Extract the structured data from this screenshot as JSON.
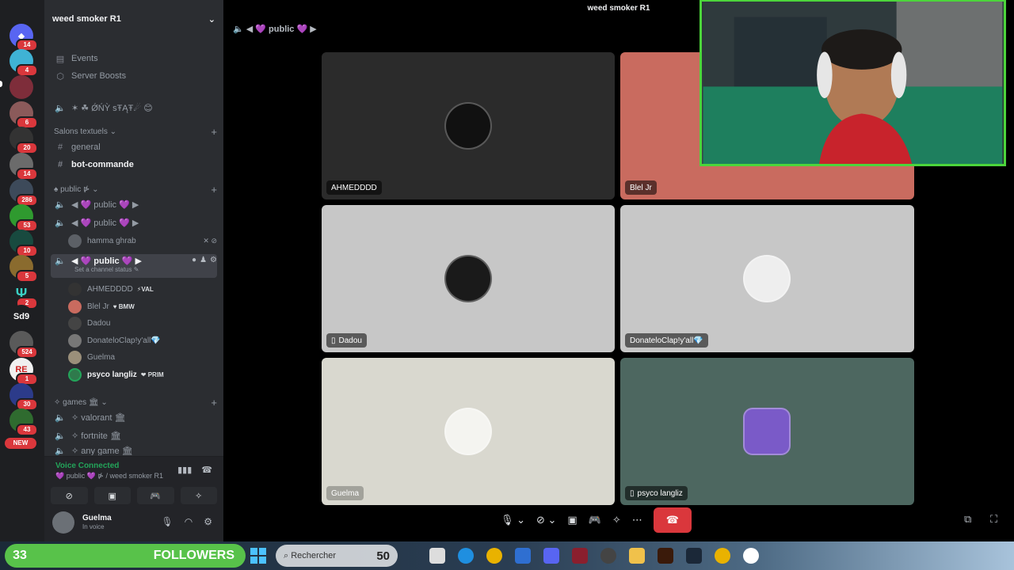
{
  "window": {
    "title": "weed smoker R1"
  },
  "server_rail": {
    "badges": [
      "14",
      "4",
      "",
      "6",
      "20",
      "14",
      "286",
      "53",
      "10",
      "5",
      "2",
      "",
      "524",
      "1",
      "30",
      "43"
    ],
    "text_server": "Sd9",
    "new_label": "NEW"
  },
  "sidebar": {
    "server_name": "weed smoker R1",
    "events": "Events",
    "boosts": "Server Boosts",
    "onlystat": "✶ ☘ ǾŃỲ sŦĄŦ☄ 😊",
    "cat_text": "Salons textuels",
    "general": "general",
    "bot_commande": "bot-commande",
    "cat_public": "♠ public ⋫",
    "voice1": "◀ 💜 public 💜 ▶",
    "voice2": "◀ 💜 public 💜 ▶",
    "voice2_member": "hamma ghrab",
    "voice_active": "◀ 💜 public 💜 ▶",
    "set_status": "Set a channel status ✎",
    "members": [
      {
        "name": "AHMEDDDD",
        "tag": "⚡VAL"
      },
      {
        "name": "Blel Jr",
        "tag": "♥ BMW"
      },
      {
        "name": "Dadou",
        "tag": ""
      },
      {
        "name": "DonateloClap!y'all💎",
        "tag": ""
      },
      {
        "name": "Guelma",
        "tag": ""
      },
      {
        "name": "psyco langliz",
        "tag": "❤ PRIM"
      }
    ],
    "cat_games": "✧ games 🏛",
    "valorant": "✧ valorant 🏛",
    "fortnite": "✧ fortnite 🏛",
    "anygame": "✧ any game 🏛"
  },
  "voice_panel": {
    "status": "Voice Connected",
    "location": "💜 public 💜 ⋫ / weed smoker R1"
  },
  "user": {
    "name": "Guelma",
    "status": "In voice"
  },
  "main": {
    "channel_title": "◀ 💜 public 💜 ▶",
    "tiles": [
      {
        "name": "AHMEDDDD",
        "mobile": false,
        "color": "#2b2b2b"
      },
      {
        "name": "Blel Jr",
        "mobile": false,
        "color": "#c96b5f"
      },
      {
        "name": "Dadou",
        "mobile": true,
        "color": "#c7c7c7"
      },
      {
        "name": "DonateloClap!y'all💎",
        "mobile": false,
        "color": "#c7c7c7"
      },
      {
        "name": "Guelma",
        "mobile": false,
        "color": "#d9d8cf"
      },
      {
        "name": "psyco langliz",
        "mobile": true,
        "color": "#4d6760"
      }
    ]
  },
  "taskbar": {
    "followers_count": "33",
    "followers_label": "FOLLOWERS",
    "search_placeholder": "Rechercher",
    "search_number": "50"
  },
  "colors": {
    "accent_green": "#23a55a",
    "danger": "#da373c",
    "follow_green": "#58c24a"
  }
}
